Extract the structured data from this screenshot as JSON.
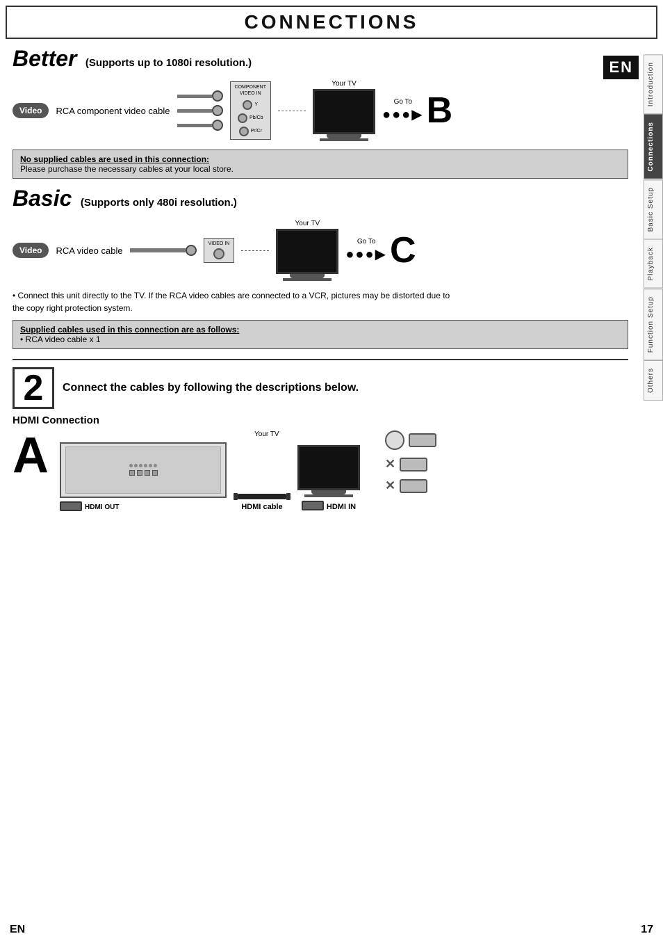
{
  "header": {
    "title": "CONNECTIONS"
  },
  "en_badge": "EN",
  "side_tabs": [
    {
      "label": "Introduction",
      "active": false
    },
    {
      "label": "Connections",
      "active": true
    },
    {
      "label": "Basic Setup",
      "active": false
    },
    {
      "label": "Playback",
      "active": false
    },
    {
      "label": "Function Setup",
      "active": false
    },
    {
      "label": "Others",
      "active": false
    }
  ],
  "better_section": {
    "title": "Better",
    "subtitle": "(Supports up to 1080i resolution.)",
    "video_badge": "Video",
    "cable_label": "RCA component video cable",
    "port_label_top": "COMPONENT\nVIDEO IN",
    "port_y": "Y",
    "port_pb": "Pb/Cb",
    "port_pr": "Pr/Cr",
    "your_tv": "Your TV",
    "go_to": "Go To",
    "letter": "B",
    "notice_title": "No supplied cables are used in this connection:",
    "notice_text": "Please purchase the necessary cables at your local store."
  },
  "basic_section": {
    "title": "Basic",
    "subtitle": "(Supports only 480i resolution.)",
    "video_badge": "Video",
    "cable_label": "RCA video cable",
    "port_label": "VIDEO IN",
    "your_tv": "Your TV",
    "go_to": "Go To",
    "letter": "C",
    "bullet1": "• Connect this unit directly to the TV. If the RCA video cables are connected to a VCR, pictures may be distorted due to",
    "bullet1b": "  the copy right protection system.",
    "supplied_title": "Supplied cables used in this connection are as follows:",
    "supplied_item": "• RCA video cable x 1"
  },
  "step2": {
    "number": "2",
    "description": "Connect the cables by following the descriptions below."
  },
  "hdmi_section": {
    "title": "HDMI Connection",
    "letter": "A",
    "your_tv": "Your TV",
    "hdmi_out_label": "HDMI OUT",
    "hdmi_cable_label": "HDMI cable",
    "hdmi_in_label": "HDMI IN"
  },
  "page_footer": {
    "en": "EN",
    "page_number": "17"
  }
}
